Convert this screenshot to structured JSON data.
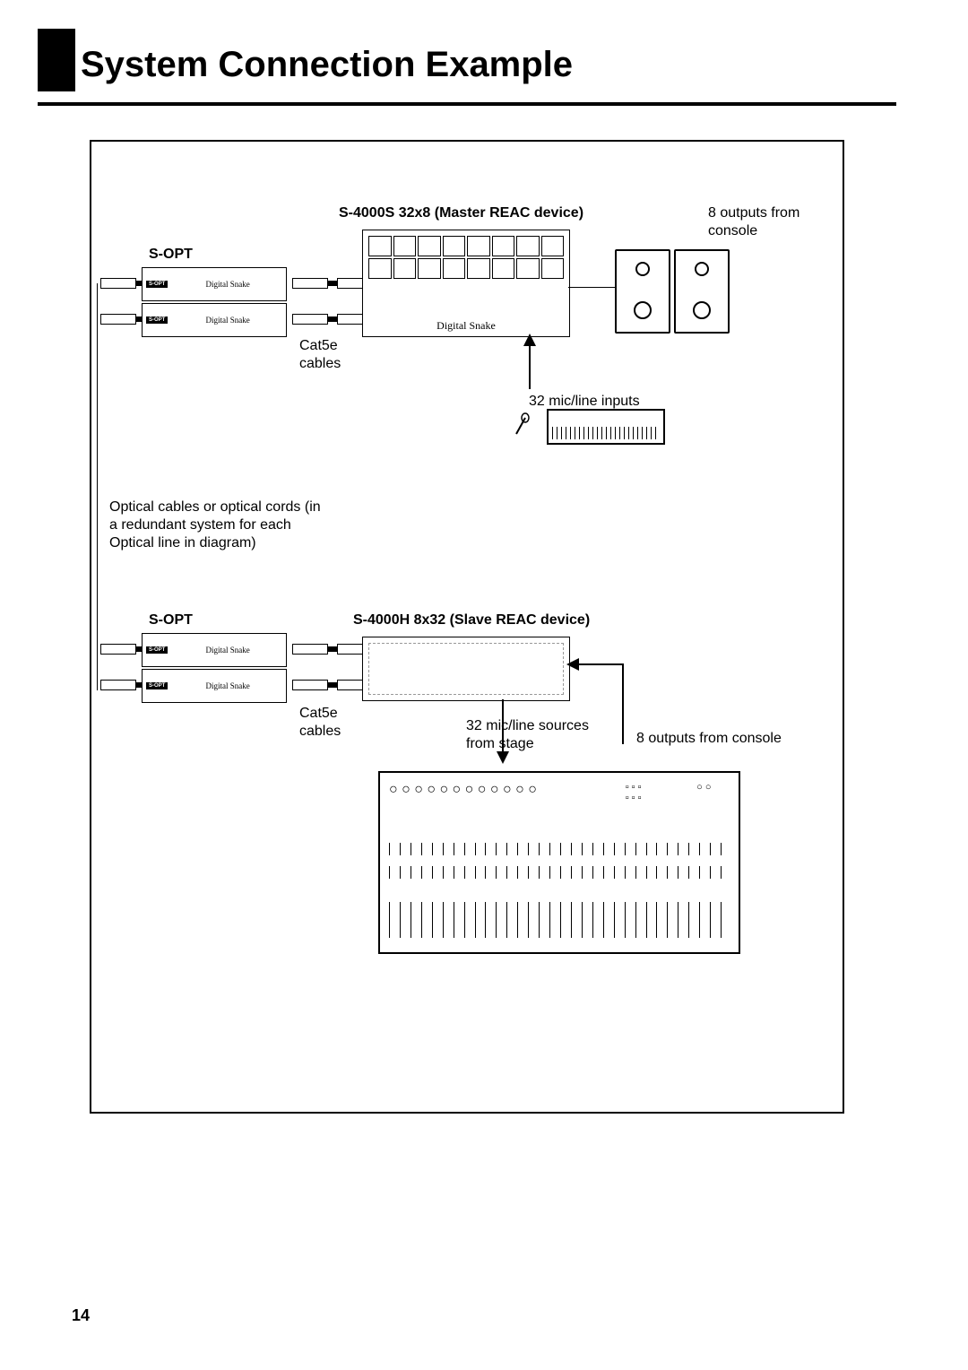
{
  "page_number": "14",
  "title": "System Connection Example",
  "labels": {
    "master": "S-4000S 32x8 (Master REAC device)",
    "sopt_top": "S-OPT",
    "sopt_bottom": "S-OPT",
    "cat5e_top": "Cat5e cables",
    "cat5e_bottom": "Cat5e cables",
    "outputs_top": "8 outputs from console",
    "outputs_bottom": "8 outputs from console",
    "inputs_32": "32 mic/line inputs",
    "optical_note": "Optical cables or optical cords (in a redundant system for each Optical line in diagram)",
    "slave": "S-4000H 8x32 (Slave REAC device)",
    "sources_32": "32 mic/line sources from stage",
    "digital_snake": "Digital Snake"
  }
}
